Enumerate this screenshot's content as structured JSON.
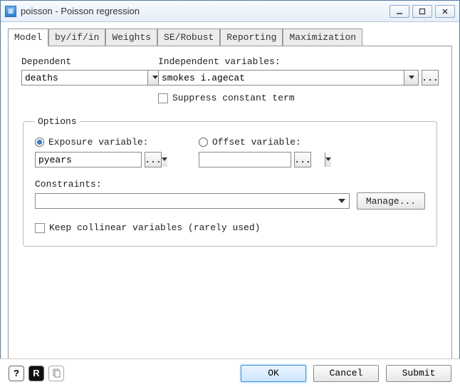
{
  "window": {
    "title": "poisson - Poisson regression"
  },
  "tabs": [
    "Model",
    "by/if/in",
    "Weights",
    "SE/Robust",
    "Reporting",
    "Maximization"
  ],
  "model": {
    "dependent_label": "Dependent",
    "dependent_value": "deaths",
    "independent_label": "Independent variables:",
    "independent_value": "smokes i.agecat",
    "suppress_constant_label": "Suppress constant term",
    "suppress_constant_checked": false
  },
  "options": {
    "legend": "Options",
    "exposure_label": "Exposure variable:",
    "exposure_value": "pyears",
    "exposure_selected": true,
    "offset_label": "Offset variable:",
    "offset_value": "",
    "offset_selected": false,
    "constraints_label": "Constraints:",
    "constraints_value": "",
    "manage_label": "Manage...",
    "keep_collinear_label": "Keep collinear variables (rarely used)",
    "keep_collinear_checked": false
  },
  "footer": {
    "ok": "OK",
    "cancel": "Cancel",
    "submit": "Submit"
  }
}
